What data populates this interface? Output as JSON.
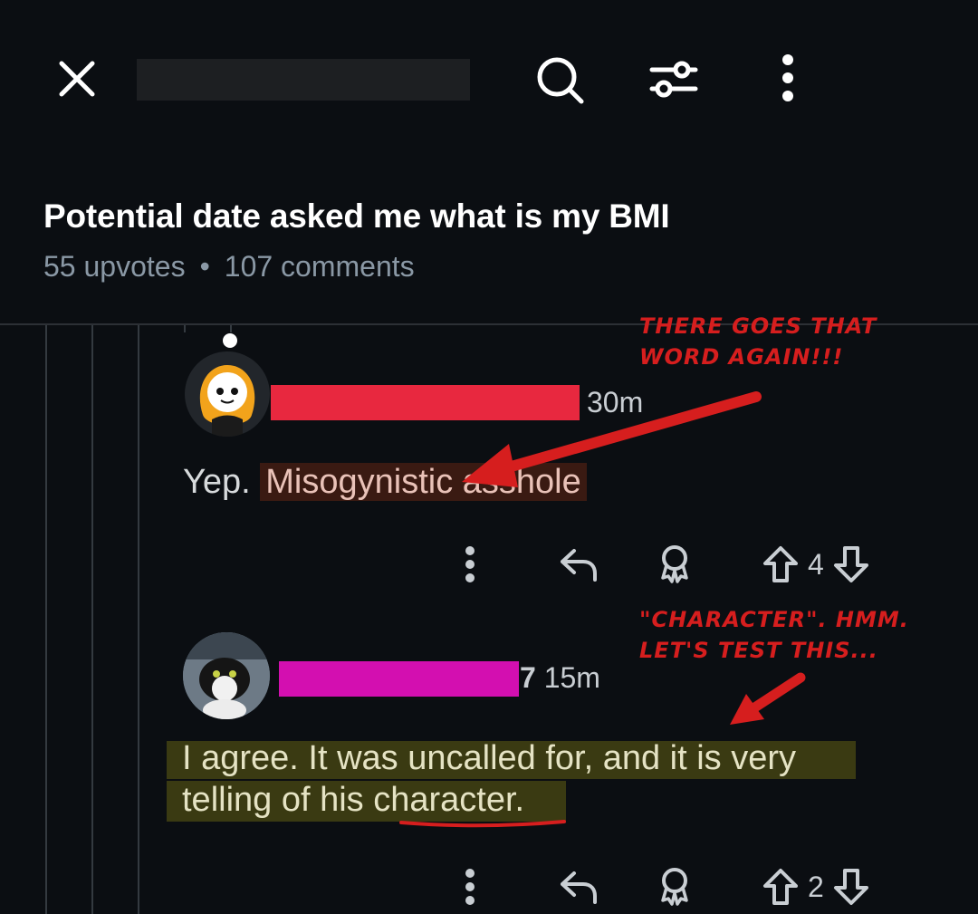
{
  "header": {
    "close_icon": "close-icon",
    "search_icon": "search-icon",
    "filter_icon": "sort-filter-icon",
    "more_icon": "more-vertical-icon"
  },
  "post": {
    "title": "Potential date asked me what is my BMI",
    "upvotes": "55 upvotes",
    "separator": "•",
    "comments": "107 comments"
  },
  "comments": [
    {
      "time": "30m",
      "text_prefix": "Yep.",
      "text_highlight": "Misogynistic asshole",
      "votes": "4",
      "redaction_color": "#e8283f"
    },
    {
      "time_prefix": "7",
      "time": "15m",
      "text_line1": "I agree. It was uncalled for, and it is very",
      "text_line2_pre": "telling of his ",
      "text_line2_word": "character.",
      "votes": "2",
      "redaction_color": "#d30fb0"
    }
  ],
  "annotations": {
    "note1_line1": "There goes that",
    "note1_line2": "word again!!!",
    "note2_line1": "\"Character\". Hmm.",
    "note2_line2": "Let's test this..."
  },
  "colors": {
    "background": "#0b0e12",
    "annotation_red": "#d61e1e",
    "highlight_red_bg": "#3a1a12",
    "highlight_yellow_bg": "#3a3a12"
  }
}
